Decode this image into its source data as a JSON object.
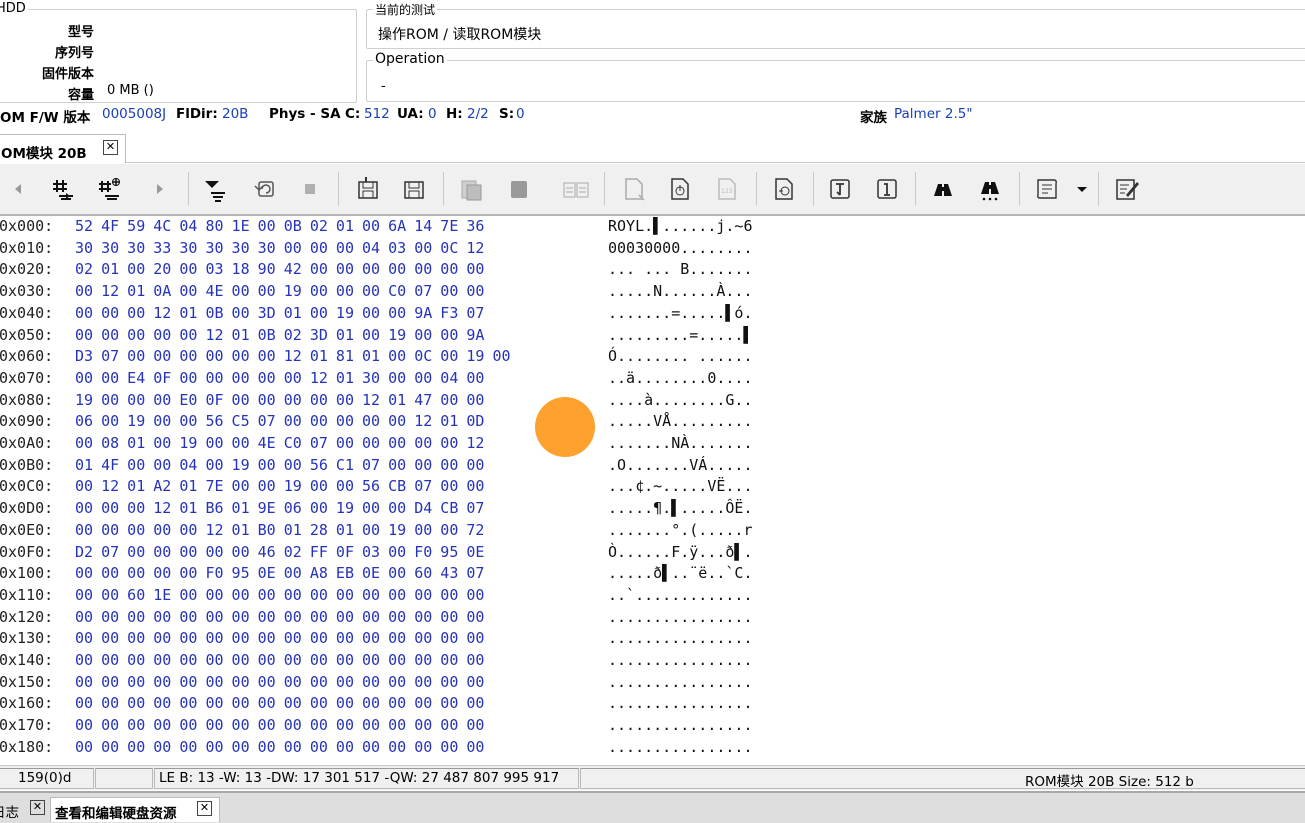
{
  "hdd": {
    "legend": "HDD",
    "labels": {
      "model": "型号",
      "serial": "序列号",
      "firmware": "固件版本",
      "capacity": "容量"
    },
    "capacity_value": "0 MB ()"
  },
  "current_test": {
    "legend": "当前的测试",
    "value": "操作ROM / 读取ROM模块"
  },
  "operation": {
    "legend": "Operation",
    "value": "-"
  },
  "info": {
    "rom_fw_label": "OM F/W 版本",
    "rom_fw_value": "0005008J",
    "fldir_label": "FlDir:",
    "fldir_value": "20B",
    "phys_label": "Phys - SA",
    "c_label": "C:",
    "c_value": "512",
    "ua_label": "UA:",
    "ua_value": "0",
    "h_label": "H:",
    "h_value": "2/2",
    "s_label": "S:",
    "s_value": "0",
    "family_label": "家族",
    "family_value": "Palmer 2.5\""
  },
  "tab": {
    "label": "OM模块 20B",
    "close": "✕"
  },
  "toolbar": {
    "icons": [
      "arrow-left-icon",
      "hash-move-icon",
      "hash-add-icon",
      "arrow-right-icon",
      "insert-down-icon",
      "refresh-icon",
      "stop-icon",
      "save-icon",
      "save-as-icon",
      "copy-icon",
      "paste-icon",
      "compare-icon",
      "page-icon",
      "import-icon",
      "numbers-icon",
      "goto-icon",
      "top-icon",
      "bottom-icon",
      "find-icon",
      "find-next-icon",
      "scroll-icon",
      "dropdown-icon",
      "edit-icon"
    ]
  },
  "hex": {
    "rows": [
      {
        "addr": "0x000:",
        "bytes": "52 4F 59 4C 04 80 1E 00 0B 02 01 00 6A 14 7E 36",
        "ascii": "ROYL.▌......j.~6"
      },
      {
        "addr": "0x010:",
        "bytes": "30 30 30 33 30 30 30 30 00 00 00 04 03 00 0C 12",
        "ascii": "00030000........"
      },
      {
        "addr": "0x020:",
        "bytes": "02 01 00 20 00 03 18 90 42 00 00 00 00 00 00 00",
        "ascii": "... ... B......."
      },
      {
        "addr": "0x030:",
        "bytes": "00 12 01 0A 00 4E 00 00 19 00 00 00 C0 07 00 00",
        "ascii": ".....N......À..."
      },
      {
        "addr": "0x040:",
        "bytes": "00 00 00 12 01 0B 00 3D 01 00 19 00 00 9A F3 07",
        "ascii": ".......=.....▌ó."
      },
      {
        "addr": "0x050:",
        "bytes": "00 00 00 00 00 12 01 0B 02 3D 01 00 19 00 00 9A",
        "ascii": ".........=.....▌"
      },
      {
        "addr": "0x060:",
        "bytes": "D3 07 00 00 00 00 00 00 12 01 81 01 00 0C 00 19 00",
        "ascii": "Ó........ ......"
      },
      {
        "addr": "0x070:",
        "bytes": "00 00 E4 0F 00 00 00 00 00 12 01 30 00 00 04 00",
        "ascii": "..ä........0...."
      },
      {
        "addr": "0x080:",
        "bytes": "19 00 00 00 E0 0F 00 00 00 00 00 12 01 47 00 00",
        "ascii": "....à........G.."
      },
      {
        "addr": "0x090:",
        "bytes": "06 00 19 00 00 56 C5 07 00 00 00 00 00 12 01 0D",
        "ascii": ".....VÅ........."
      },
      {
        "addr": "0x0A0:",
        "bytes": "00 08 01 00 19 00 00 4E C0 07 00 00 00 00 00 12",
        "ascii": ".......NÀ......."
      },
      {
        "addr": "0x0B0:",
        "bytes": "01 4F 00 00 04 00 19 00 00 56 C1 07 00 00 00 00",
        "ascii": ".O.......VÁ....."
      },
      {
        "addr": "0x0C0:",
        "bytes": "00 12 01 A2 01 7E 00 00 19 00 00 56 CB 07 00 00",
        "ascii": "...¢.~.....VË..."
      },
      {
        "addr": "0x0D0:",
        "bytes": "00 00 00 12 01 B6 01 9E 06 00 19 00 00 D4 CB 07",
        "ascii": ".....¶.▌.....ÔË."
      },
      {
        "addr": "0x0E0:",
        "bytes": "00 00 00 00 00 12 01 B0 01 28 01 00 19 00 00 72",
        "ascii": ".......°.(.....r"
      },
      {
        "addr": "0x0F0:",
        "bytes": "D2 07 00 00 00 00 00 46 02 FF 0F 03 00 F0 95 0E",
        "ascii": "Ò......F.ÿ...ð▌."
      },
      {
        "addr": "0x100:",
        "bytes": "00 00 00 00 00 F0 95 0E 00 A8 EB 0E 00 60 43 07",
        "ascii": ".....ð▌..¨ë..`C."
      },
      {
        "addr": "0x110:",
        "bytes": "00 00 60 1E 00 00 00 00 00 00 00 00 00 00 00 00",
        "ascii": "..`............."
      },
      {
        "addr": "0x120:",
        "bytes": "00 00 00 00 00 00 00 00 00 00 00 00 00 00 00 00",
        "ascii": "................"
      },
      {
        "addr": "0x130:",
        "bytes": "00 00 00 00 00 00 00 00 00 00 00 00 00 00 00 00",
        "ascii": "................"
      },
      {
        "addr": "0x140:",
        "bytes": "00 00 00 00 00 00 00 00 00 00 00 00 00 00 00 00",
        "ascii": "................"
      },
      {
        "addr": "0x150:",
        "bytes": "00 00 00 00 00 00 00 00 00 00 00 00 00 00 00 00",
        "ascii": "................"
      },
      {
        "addr": "0x160:",
        "bytes": "00 00 00 00 00 00 00 00 00 00 00 00 00 00 00 00",
        "ascii": "................"
      },
      {
        "addr": "0x170:",
        "bytes": "00 00 00 00 00 00 00 00 00 00 00 00 00 00 00 00",
        "ascii": "................"
      },
      {
        "addr": "0x180:",
        "bytes": "00 00 00 00 00 00 00 00 00 00 00 00 00 00 00 00",
        "ascii": "................"
      }
    ]
  },
  "status": {
    "offset": "159(0)d",
    "empty": "",
    "values": "LE B: 13 -W: 13 -DW: 17 301 517 -QW: 27 487 807 995 917",
    "module": "ROM模块 20B Size: 512 b"
  },
  "bottom_tabs": [
    {
      "label": "日志",
      "close": "✕"
    },
    {
      "label": "查看和编辑硬盘资源",
      "close": "✕"
    }
  ]
}
